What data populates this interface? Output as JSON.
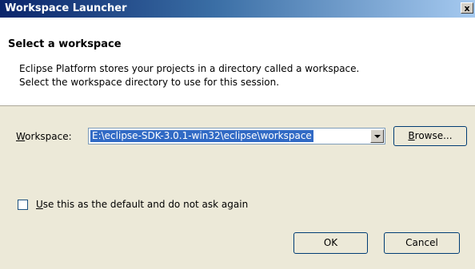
{
  "window": {
    "title": "Workspace Launcher",
    "close_glyph": "x"
  },
  "header": {
    "title": "Select a workspace",
    "desc_line1": "Eclipse Platform stores your projects in a directory called a workspace.",
    "desc_line2": "Select the workspace directory to use for this session."
  },
  "workspace": {
    "label_mnemonic": "W",
    "label_rest": "orkspace:",
    "value": "E:\\eclipse-SDK-3.0.1-win32\\eclipse\\workspace",
    "dropdown_icon": "chevron-down-icon"
  },
  "browse": {
    "mnemonic": "B",
    "rest": "rowse..."
  },
  "default_option": {
    "checked": false,
    "label_mnemonic": "U",
    "label_rest": "se this as the default and do not ask again"
  },
  "actions": {
    "ok_label": "OK",
    "cancel_label": "Cancel"
  }
}
